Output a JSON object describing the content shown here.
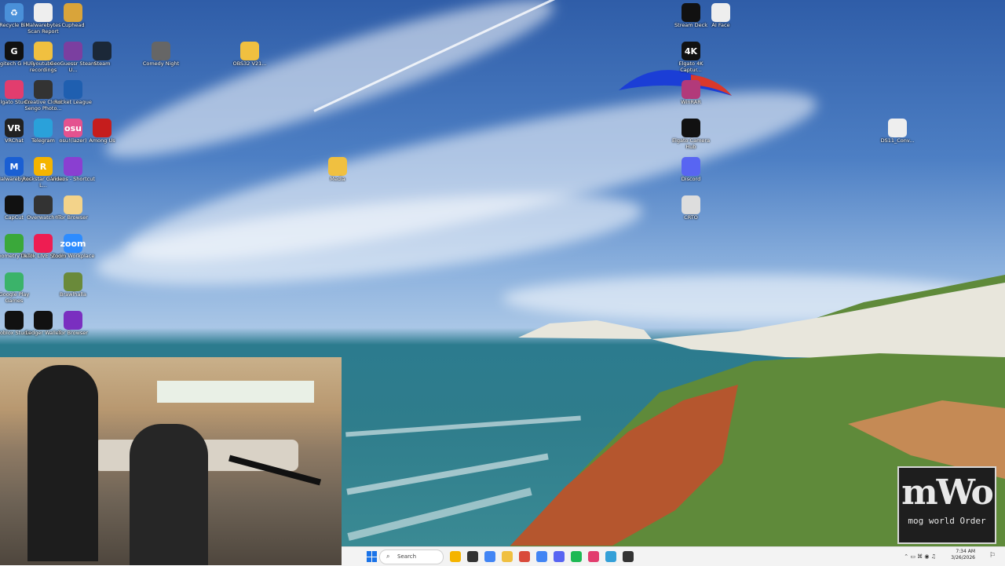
{
  "desktop_icons": [
    {
      "label": "Recycle Bin",
      "color": "#4a90d9",
      "glyph": "♻"
    },
    {
      "label": "Malwarebytes Scan Report",
      "color": "#eeeeee",
      "glyph": ""
    },
    {
      "label": "Cuphead",
      "color": "#d9a43a",
      "glyph": ""
    },
    {
      "label": "Logitech G HUB",
      "color": "#111111",
      "glyph": "G"
    },
    {
      "label": "youtube recordings",
      "color": "#f0c040",
      "glyph": ""
    },
    {
      "label": "GeoGuessr Steam U...",
      "color": "#7b3fa0",
      "glyph": ""
    },
    {
      "label": "Steam",
      "color": "#1b2838",
      "glyph": ""
    },
    {
      "label": "Comedy Night",
      "color": "#666666",
      "glyph": ""
    },
    {
      "label": "OBS32 V21...",
      "color": "#f0c040",
      "glyph": ""
    },
    {
      "label": "Elgato Studio",
      "color": "#e23d6e",
      "glyph": ""
    },
    {
      "label": "Creative Cloud Sengo Photo...",
      "color": "#333333",
      "glyph": ""
    },
    {
      "label": "Rocket League",
      "color": "#1f5fb0",
      "glyph": ""
    },
    {
      "label": "VRChat",
      "color": "#222222",
      "glyph": "VR"
    },
    {
      "label": "Telegram",
      "color": "#2aa1da",
      "glyph": ""
    },
    {
      "label": "osu!(lazer)",
      "color": "#e4528f",
      "glyph": "osu"
    },
    {
      "label": "Among Us",
      "color": "#c51d1d",
      "glyph": ""
    },
    {
      "label": "Malwarebytes",
      "color": "#1a5fd3",
      "glyph": "M"
    },
    {
      "label": "Rockstar Games L...",
      "color": "#f5b400",
      "glyph": "R"
    },
    {
      "label": "Videos - Shortcut",
      "color": "#8a3fd1",
      "glyph": ""
    },
    {
      "label": "Media",
      "color": "#f0c040",
      "glyph": ""
    },
    {
      "label": "CapCut",
      "color": "#111111",
      "glyph": ""
    },
    {
      "label": "Overwatch®",
      "color": "#333333",
      "glyph": ""
    },
    {
      "label": "Tor Browser",
      "color": "#f3d38a",
      "glyph": ""
    },
    {
      "label": "Geometry Dash",
      "color": "#3aa83a",
      "glyph": ""
    },
    {
      "label": "TikTok LIVE Studio",
      "color": "#ee1d52",
      "glyph": ""
    },
    {
      "label": "Zoom Workplace",
      "color": "#2d8cff",
      "glyph": "zoom"
    },
    {
      "label": "Google Play Games",
      "color": "#3bb36a",
      "glyph": ""
    },
    {
      "label": "Brawlhalla",
      "color": "#6a8a3a",
      "glyph": ""
    },
    {
      "label": "Roblox Studio",
      "color": "#111111",
      "glyph": ""
    },
    {
      "label": "Ledger Wallet",
      "color": "#111111",
      "glyph": ""
    },
    {
      "label": "Tor Browser",
      "color": "#7a2fc0",
      "glyph": ""
    },
    {
      "label": "Stream Deck",
      "color": "#111111",
      "glyph": ""
    },
    {
      "label": "AI Face",
      "color": "#eeeeee",
      "glyph": ""
    },
    {
      "label": "Elgato 4K Captur...",
      "color": "#111111",
      "glyph": "4K"
    },
    {
      "label": "WinRAR",
      "color": "#b23a7a",
      "glyph": ""
    },
    {
      "label": "Elgato Camera Hub",
      "color": "#111111",
      "glyph": ""
    },
    {
      "label": "Discord",
      "color": "#5865f2",
      "glyph": ""
    },
    {
      "label": "CRTO",
      "color": "#dddddd",
      "glyph": ""
    },
    {
      "label": "DS11_Conv...",
      "color": "#eeeeee",
      "glyph": ""
    }
  ],
  "taskbar": {
    "search_placeholder": "Search",
    "apps": [
      "#f5b400",
      "#333333",
      "#4285f4",
      "#f0c040",
      "#d94a3a",
      "#4285f4",
      "#5865f2",
      "#1db954",
      "#e23d6e",
      "#34a0d8",
      "#333333"
    ],
    "time": "7:34 AM",
    "date": "3/26/2026"
  },
  "watermark": {
    "big": "mWo",
    "small": "mog world Order"
  },
  "colors": {
    "sky_top": "#2f5da8",
    "sea": "#2f7d8c",
    "cliff_white": "#e8e6dc",
    "grass": "#5f8a3a",
    "dirt": "#b5562e",
    "taskbar": "#f3f3f3"
  }
}
